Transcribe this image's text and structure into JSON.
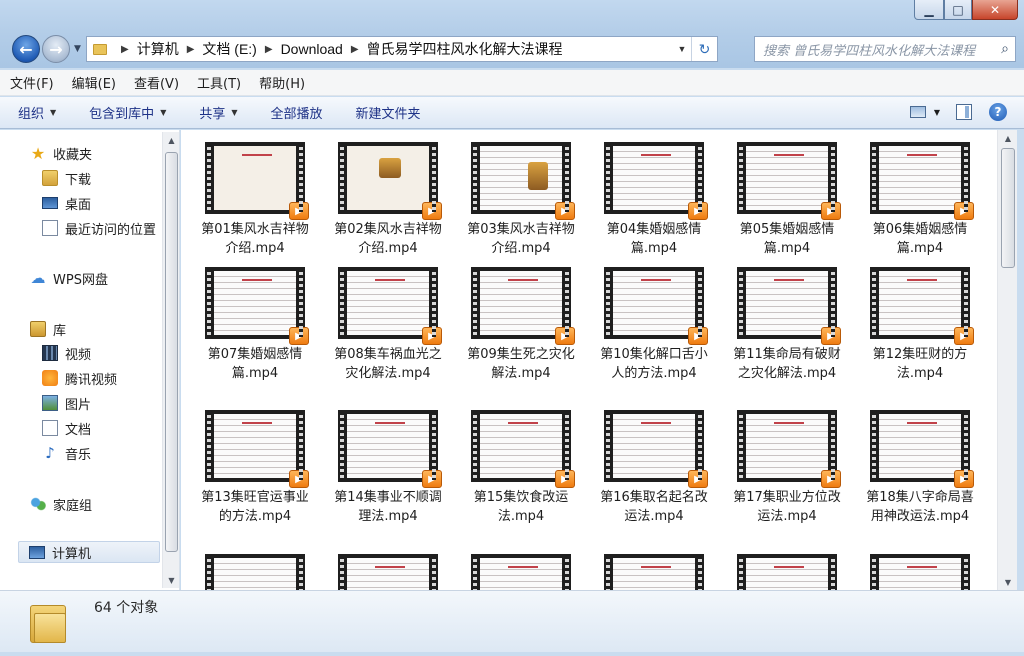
{
  "window": {
    "minimize": "▁",
    "maximize": "□",
    "close": "✕"
  },
  "breadcrumb": [
    "计算机",
    "文档 (E:)",
    "Download",
    "曾氏易学四柱风水化解大法课程"
  ],
  "search": {
    "placeholder": "搜索 曾氏易学四柱风水化解大法课程"
  },
  "menu": [
    "文件(F)",
    "编辑(E)",
    "查看(V)",
    "工具(T)",
    "帮助(H)"
  ],
  "commands": [
    {
      "label": "组织",
      "dropdown": true
    },
    {
      "label": "包含到库中",
      "dropdown": true
    },
    {
      "label": "共享",
      "dropdown": true
    },
    {
      "label": "全部播放",
      "dropdown": false
    },
    {
      "label": "新建文件夹",
      "dropdown": false
    }
  ],
  "sidebar": {
    "favorites": {
      "label": "收藏夹",
      "items": [
        "下载",
        "桌面",
        "最近访问的位置"
      ]
    },
    "wps": "WPS网盘",
    "libraries": {
      "label": "库",
      "items": [
        "视频",
        "腾讯视频",
        "图片",
        "文档",
        "音乐"
      ]
    },
    "homegroup": "家庭组",
    "computer": "计算机"
  },
  "files": [
    "第01集风水吉祥物介绍.mp4",
    "第02集风水吉祥物介绍.mp4",
    "第03集风水吉祥物介绍.mp4",
    "第04集婚姻感情篇.mp4",
    "第05集婚姻感情篇.mp4",
    "第06集婚姻感情篇.mp4",
    "第07集婚姻感情篇.mp4",
    "第08集车祸血光之灾化解法.mp4",
    "第09集生死之灾化解法.mp4",
    "第10集化解口舌小人的方法.mp4",
    "第11集命局有破财之灾化解法.mp4",
    "第12集旺财的方法.mp4",
    "第13集旺官运事业的方法.mp4",
    "第14集事业不顺调理法.mp4",
    "第15集饮食改运法.mp4",
    "第16集取名起名改运法.mp4",
    "第17集职业方位改运法.mp4",
    "第18集八字命局喜用神改运法.mp4"
  ],
  "status": {
    "count": "64 个对象"
  },
  "colors": {
    "accent": "#1e3287",
    "play_badge": "#ef7b10"
  }
}
